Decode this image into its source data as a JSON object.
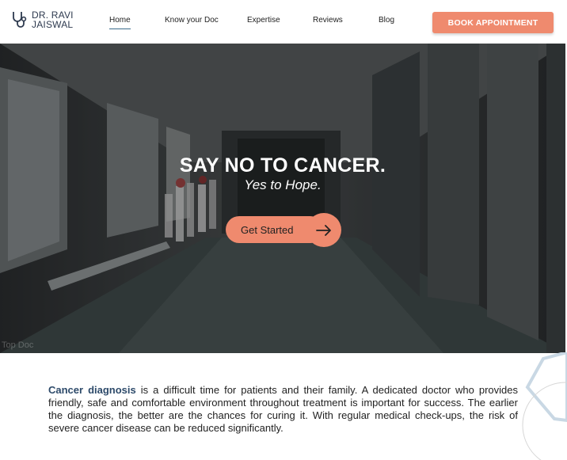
{
  "brand": {
    "line1": "DR. RAVI",
    "line2": "JAISWAL"
  },
  "nav": {
    "items": [
      {
        "label": "Home",
        "active": true
      },
      {
        "label": "Know your Doc",
        "active": false
      },
      {
        "label": "Expertise",
        "active": false
      },
      {
        "label": "Reviews",
        "active": false
      },
      {
        "label": "Blog",
        "active": false
      }
    ],
    "cta_label": "BOOK APPOINTMENT"
  },
  "hero": {
    "title": "SAY NO TO CANCER.",
    "subtitle": "Yes to Hope.",
    "button_label": "Get Started",
    "watermark": "Top Doc"
  },
  "intro": {
    "highlight": "Cancer diagnosis",
    "text": " is a difficult time for patients and their family. A dedicated doctor who provides friendly, safe and comfortable environment throughout treatment is important for success. The earlier the diagnosis, the better are the chances for curing it. With regular medical check-ups, the risk of severe cancer disease can be reduced significantly."
  },
  "colors": {
    "accent": "#ef8a6e",
    "brand_blue": "#2d4a6a",
    "nav_underline": "#3a6b8a"
  },
  "icons": {
    "logo": "stethoscope-icon",
    "cta": "arrow-right-icon"
  }
}
